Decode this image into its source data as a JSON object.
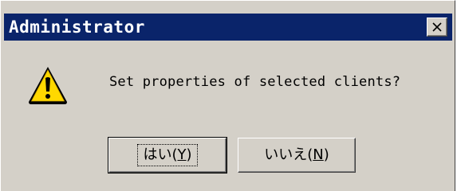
{
  "window": {
    "title": "Administrator",
    "close_label": "×"
  },
  "dialog": {
    "icon": "warning-icon",
    "message": "Set properties of selected clients?"
  },
  "buttons": {
    "yes": {
      "prefix": "はい(",
      "mnemonic": "Y",
      "suffix": ")"
    },
    "no": {
      "prefix": "いいえ(",
      "mnemonic": "N",
      "suffix": ")"
    }
  },
  "colors": {
    "titlebar": "#0a246a",
    "face": "#d4d0c8",
    "warning_yellow": "#ffd800"
  }
}
